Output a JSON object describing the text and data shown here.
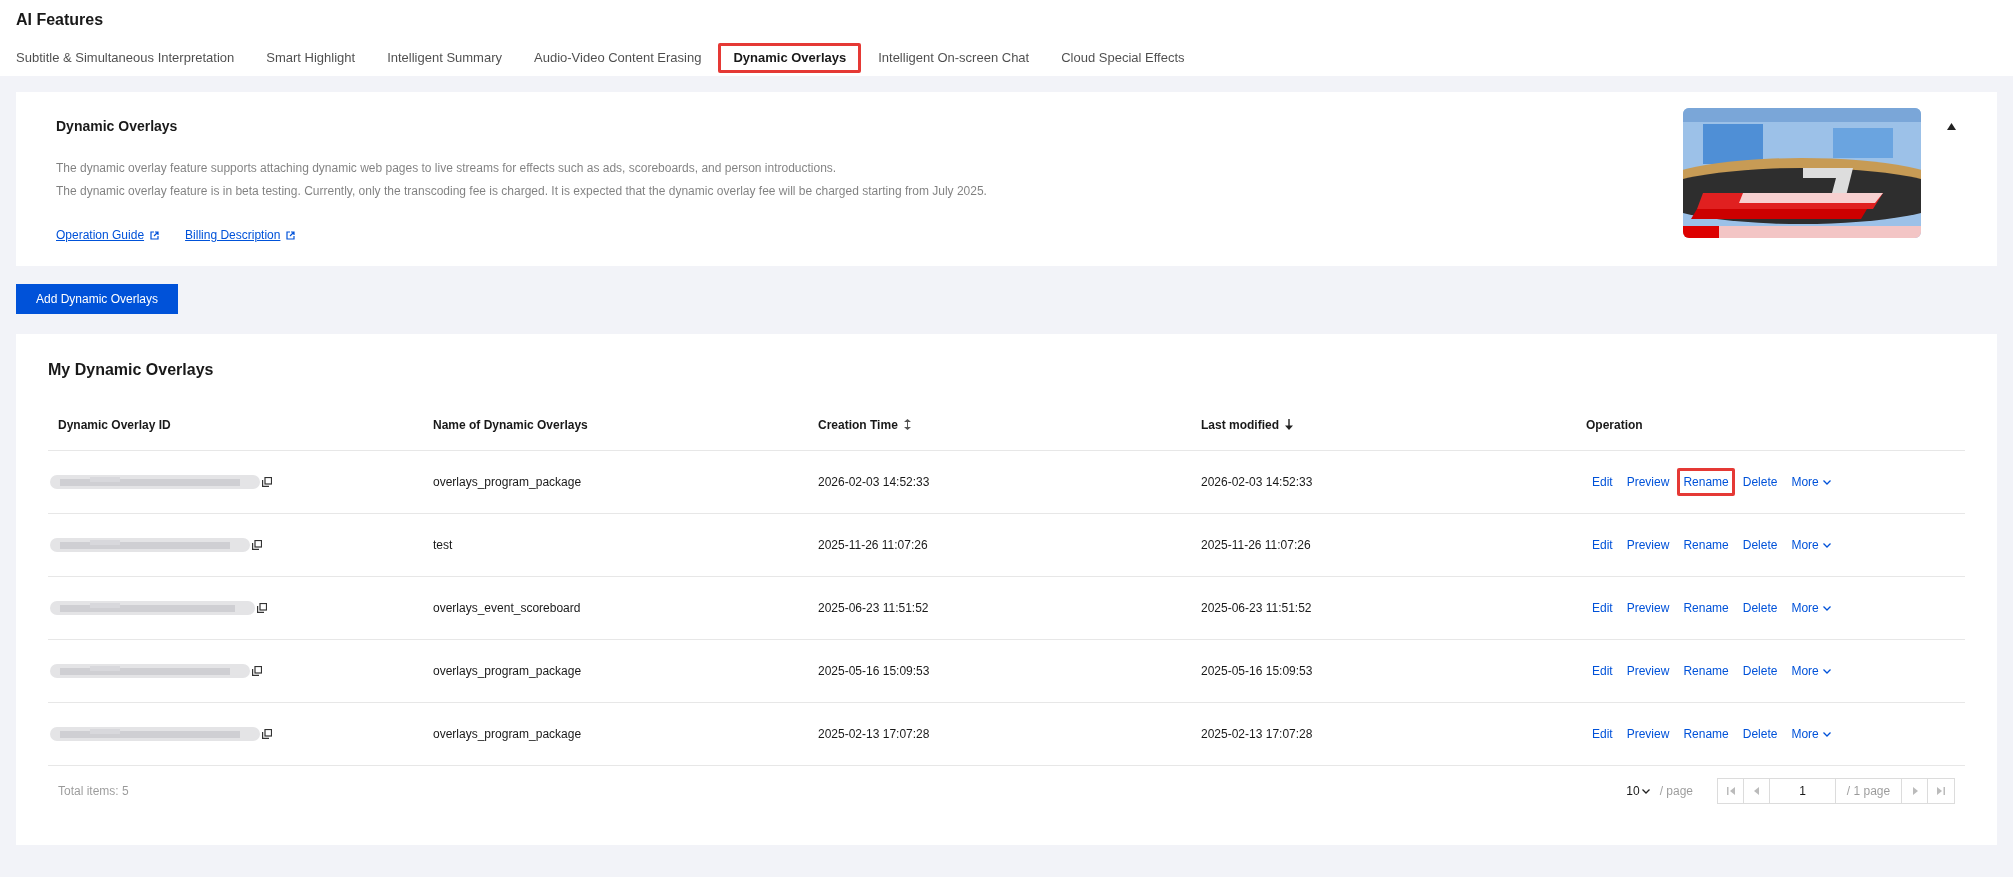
{
  "page_title": "AI Features",
  "tabs": [
    {
      "label": "Subtitle & Simultaneous Interpretation",
      "selected": false,
      "highlighted": false
    },
    {
      "label": "Smart Highlight",
      "selected": false,
      "highlighted": false
    },
    {
      "label": "Intelligent Summary",
      "selected": false,
      "highlighted": false
    },
    {
      "label": "Audio-Video Content Erasing",
      "selected": false,
      "highlighted": false
    },
    {
      "label": "Dynamic Overlays",
      "selected": true,
      "highlighted": true
    },
    {
      "label": "Intelligent On-screen Chat",
      "selected": false,
      "highlighted": false
    },
    {
      "label": "Cloud Special Effects",
      "selected": false,
      "highlighted": false
    }
  ],
  "intro": {
    "title": "Dynamic Overlays",
    "paragraphs": [
      "The dynamic overlay feature supports attaching dynamic web pages to live streams for effects such as ads, scoreboards, and person introductions.",
      "The dynamic overlay feature is in beta testing. Currently, only the transcoding fee is charged. It is expected that the dynamic overlay fee will be charged starting from July 2025."
    ],
    "links": [
      "Operation Guide",
      "Billing Description"
    ],
    "expanded": true
  },
  "add_button": "Add Dynamic Overlays",
  "table": {
    "title": "My Dynamic Overlays",
    "columns": [
      {
        "label": "Dynamic Overlay ID",
        "kind": "plain"
      },
      {
        "label": "Name of Dynamic Overlays",
        "kind": "plain"
      },
      {
        "label": "Creation Time",
        "kind": "sortable"
      },
      {
        "label": "Last modified",
        "kind": "sorted"
      },
      {
        "label": "Operation",
        "kind": "plain"
      }
    ],
    "rows": [
      {
        "name": "overlays_program_package",
        "created": "2026-02-03 14:52:33",
        "modified": "2026-02-03 14:52:33",
        "actions": [
          {
            "label": "Edit",
            "highlighted": false
          },
          {
            "label": "Preview",
            "highlighted": false
          },
          {
            "label": "Rename",
            "highlighted": true
          },
          {
            "label": "Delete",
            "highlighted": false
          },
          {
            "label": "More",
            "highlighted": false
          }
        ]
      },
      {
        "name": "test",
        "created": "2025-11-26 11:07:26",
        "modified": "2025-11-26 11:07:26",
        "actions": [
          {
            "label": "Edit",
            "highlighted": false
          },
          {
            "label": "Preview",
            "highlighted": false
          },
          {
            "label": "Rename",
            "highlighted": false
          },
          {
            "label": "Delete",
            "highlighted": false
          },
          {
            "label": "More",
            "highlighted": false
          }
        ]
      },
      {
        "name": "overlays_event_scoreboard",
        "created": "2025-06-23 11:51:52",
        "modified": "2025-06-23 11:51:52",
        "actions": [
          {
            "label": "Edit",
            "highlighted": false
          },
          {
            "label": "Preview",
            "highlighted": false
          },
          {
            "label": "Rename",
            "highlighted": false
          },
          {
            "label": "Delete",
            "highlighted": false
          },
          {
            "label": "More",
            "highlighted": false
          }
        ]
      },
      {
        "name": "overlays_program_package",
        "created": "2025-05-16 15:09:53",
        "modified": "2025-05-16 15:09:53",
        "actions": [
          {
            "label": "Edit",
            "highlighted": false
          },
          {
            "label": "Preview",
            "highlighted": false
          },
          {
            "label": "Rename",
            "highlighted": false
          },
          {
            "label": "Delete",
            "highlighted": false
          },
          {
            "label": "More",
            "highlighted": false
          }
        ]
      },
      {
        "name": "overlays_program_package",
        "created": "2025-02-13 17:07:28",
        "modified": "2025-02-13 17:07:28",
        "actions": [
          {
            "label": "Edit",
            "highlighted": false
          },
          {
            "label": "Preview",
            "highlighted": false
          },
          {
            "label": "Rename",
            "highlighted": false
          },
          {
            "label": "Delete",
            "highlighted": false
          },
          {
            "label": "More",
            "highlighted": false
          }
        ]
      }
    ]
  },
  "pagination": {
    "total": "Total items: 5",
    "page_size": "10",
    "per_page": "/ page",
    "page": "1",
    "page_count": "/ 1 page"
  }
}
